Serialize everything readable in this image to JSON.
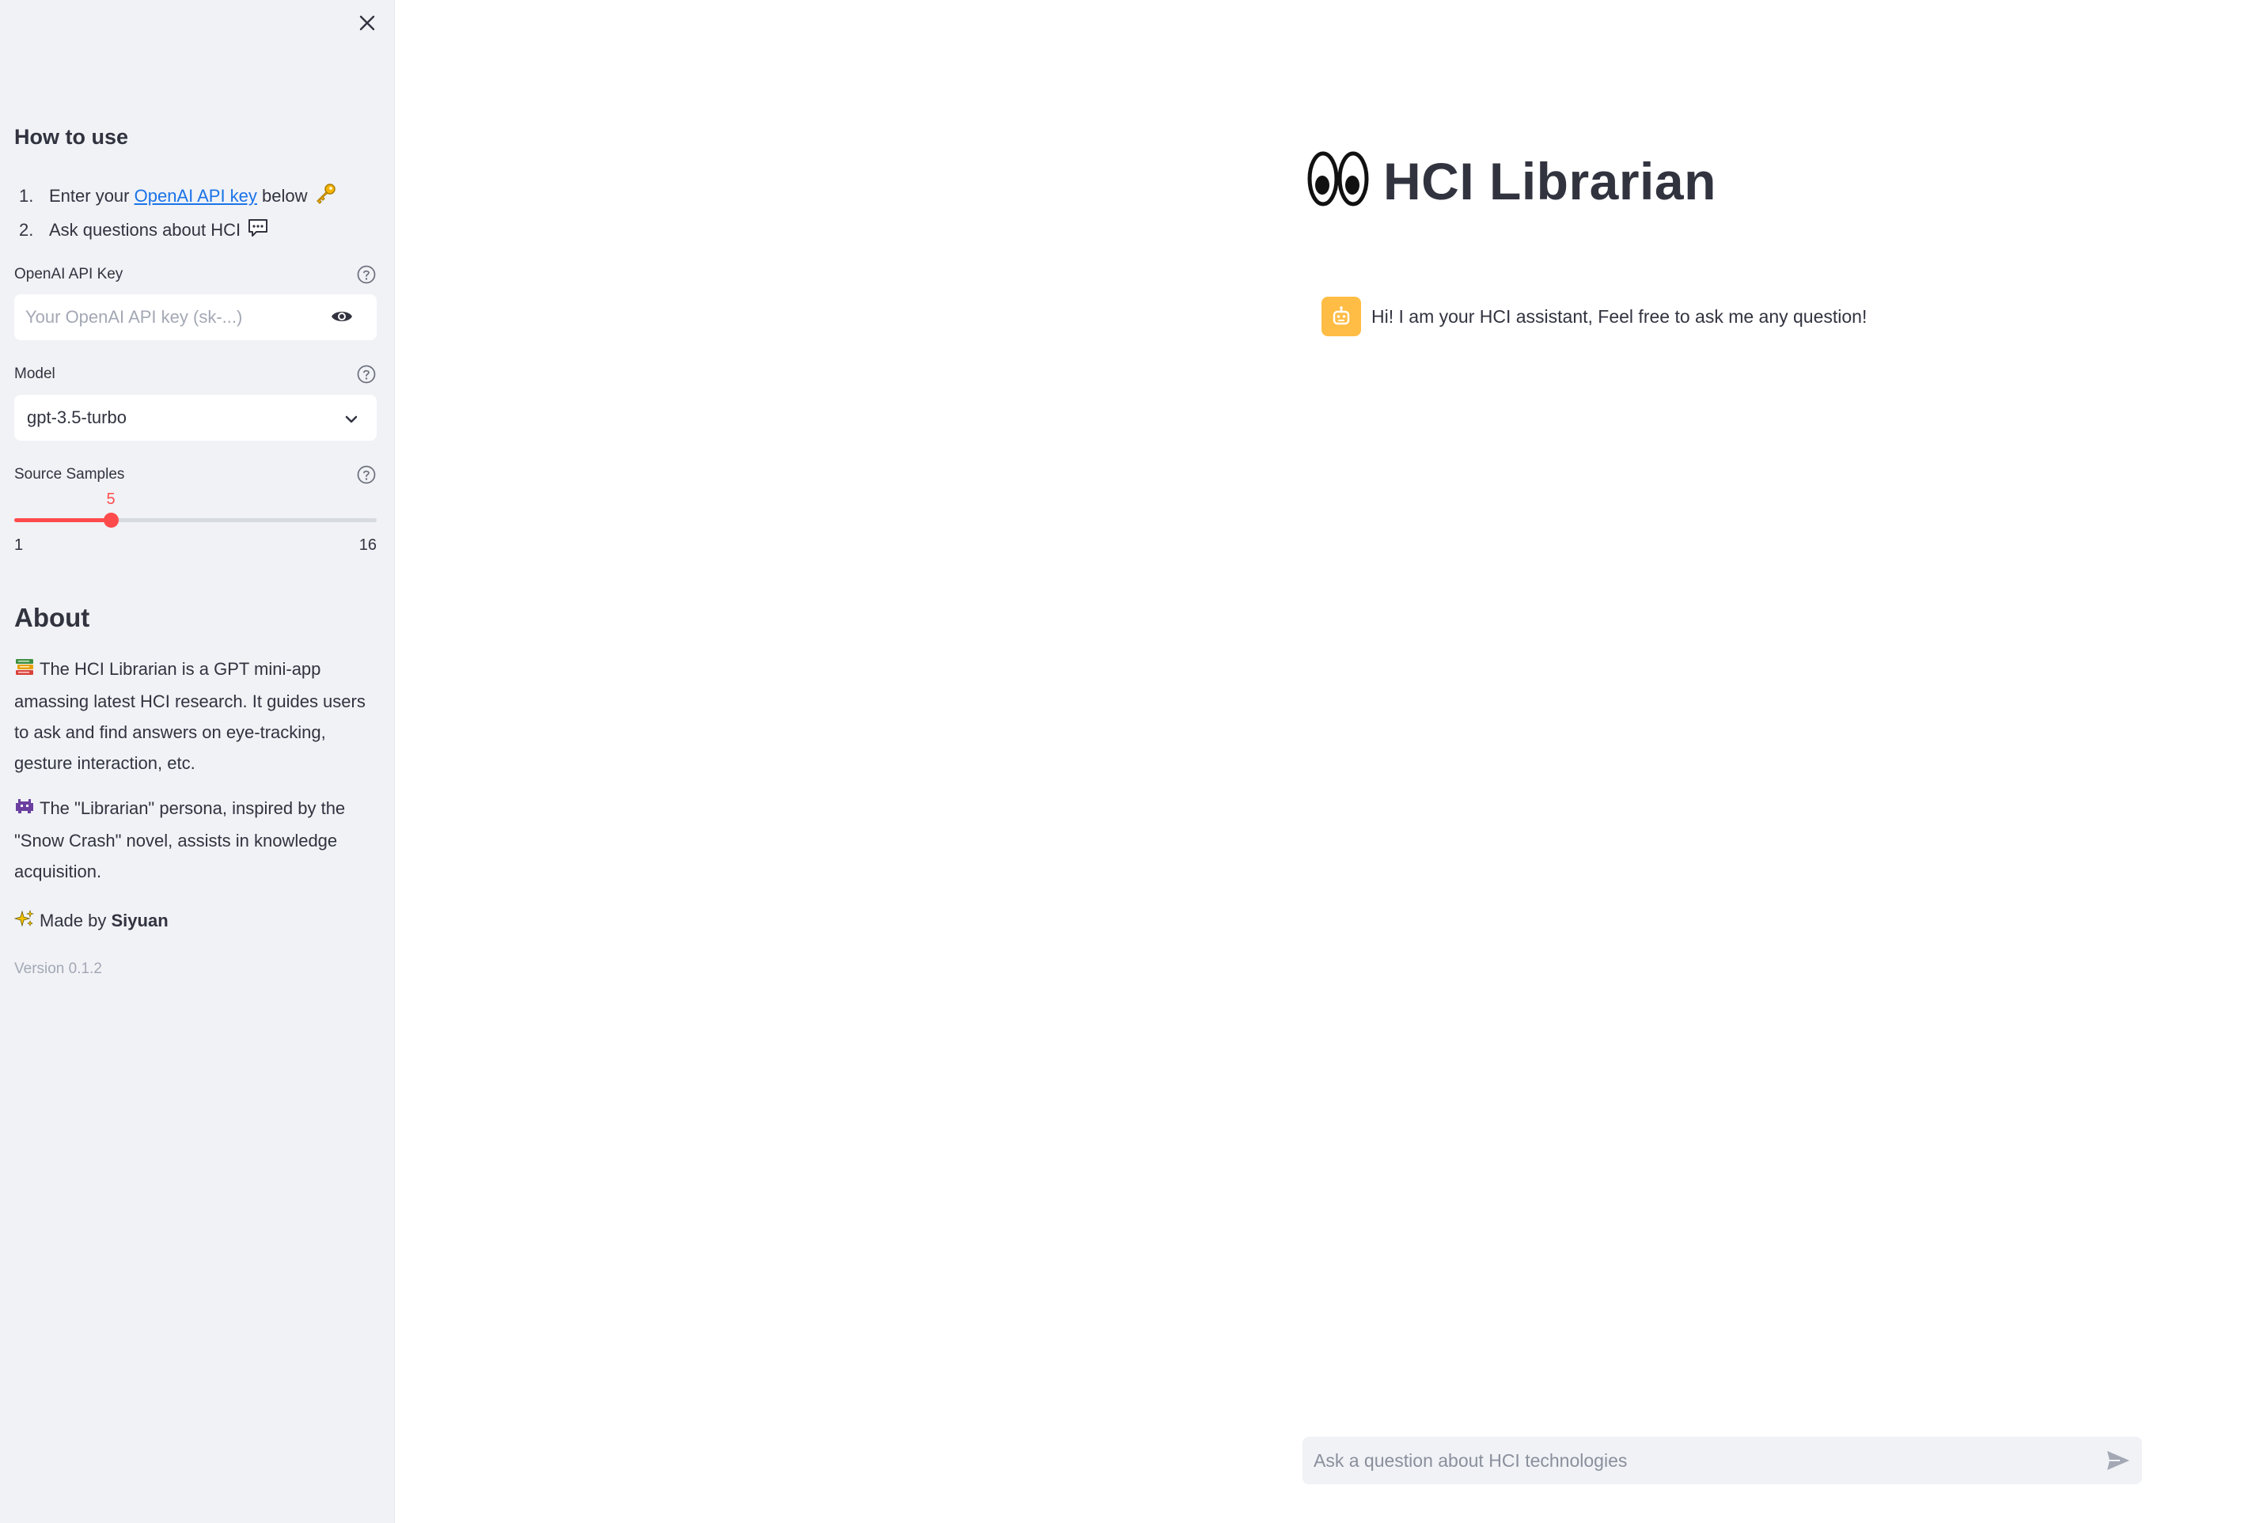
{
  "sidebar": {
    "how_to_use_heading": "How to use",
    "steps": [
      {
        "num": "1.",
        "prefix": "Enter your ",
        "link": "OpenAI API key",
        "suffix": " below",
        "emoji": "key-emoji"
      },
      {
        "num": "2.",
        "text": "Ask questions about HCI",
        "emoji": "speech-bubble-emoji"
      }
    ],
    "api_key": {
      "label": "OpenAI API Key",
      "placeholder": "Your OpenAI API key (sk-...)",
      "value": ""
    },
    "model": {
      "label": "Model",
      "value": "gpt-3.5-turbo"
    },
    "source_samples": {
      "label": "Source Samples",
      "value": "5",
      "min": "1",
      "max": "16",
      "fraction": 0.2667
    },
    "about_heading": "About",
    "about_paragraphs": {
      "p1": "The HCI Librarian is a GPT mini-app amassing latest HCI research. It guides users to ask and find answers on eye-tracking, gesture interaction, etc.",
      "p2": "The \"Librarian\" persona, inspired by the \"Snow Crash\" novel, assists in knowledge acquisition.",
      "p3_prefix": "Made by ",
      "p3_name": "Siyuan"
    },
    "version": "Version 0.1.2"
  },
  "main": {
    "title": "HCI Librarian",
    "title_icon": "eyes-emoji",
    "assistant_message": "Hi! I am your HCI assistant, Feel free to ask me any question!",
    "chat_input_placeholder": "Ask a question about HCI technologies"
  },
  "colors": {
    "sidebar_bg": "#f0f2f6",
    "accent": "#ff4b4b",
    "link": "#1a73e8",
    "avatar_bg": "#ffbd45",
    "text": "#31333f"
  }
}
